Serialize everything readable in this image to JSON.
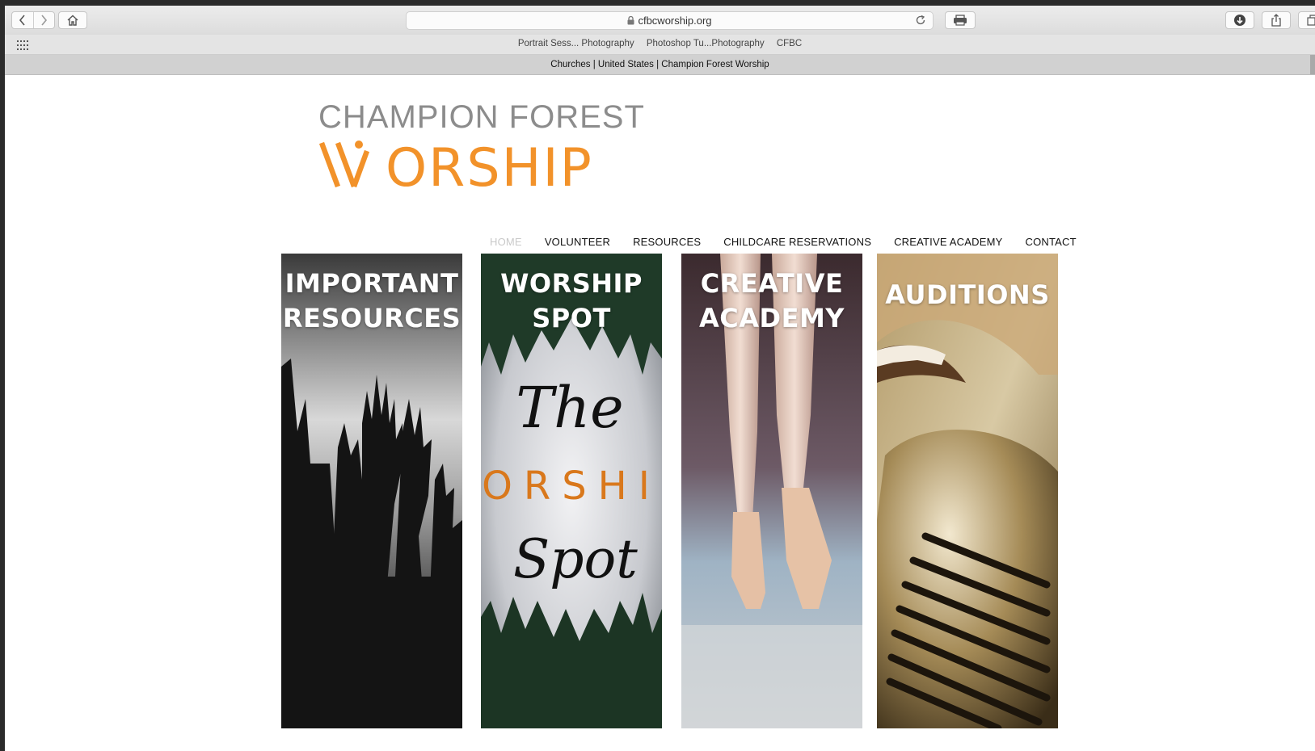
{
  "browser": {
    "url": "cfbcworship.org",
    "favorites": [
      "Portrait Sess... Photography",
      "Photoshop Tu...Photography",
      "CFBC"
    ],
    "tab_title": "Churches | United States | Champion Forest Worship"
  },
  "logo": {
    "top_line": "CHAMPION FOREST",
    "bottom_line": "WORSHIP",
    "accent_color": "#f2922a"
  },
  "nav": {
    "items": [
      {
        "label": "HOME"
      },
      {
        "label": "VOLUNTEER"
      },
      {
        "label": "RESOURCES"
      },
      {
        "label": "CHILDCARE RESERVATIONS"
      },
      {
        "label": "CREATIVE ACADEMY"
      },
      {
        "label": "CONTACT"
      }
    ]
  },
  "tiles": [
    {
      "line1": "IMPORTANT",
      "line2": "RESOURCES"
    },
    {
      "line1": "WORSHIP",
      "line2": "SPOT",
      "script_top": "The",
      "middle": "ORSHI",
      "script_bottom": "Spot"
    },
    {
      "line1": "CREATIVE",
      "line2": "ACADEMY"
    },
    {
      "line1": "AUDITIONS"
    }
  ]
}
